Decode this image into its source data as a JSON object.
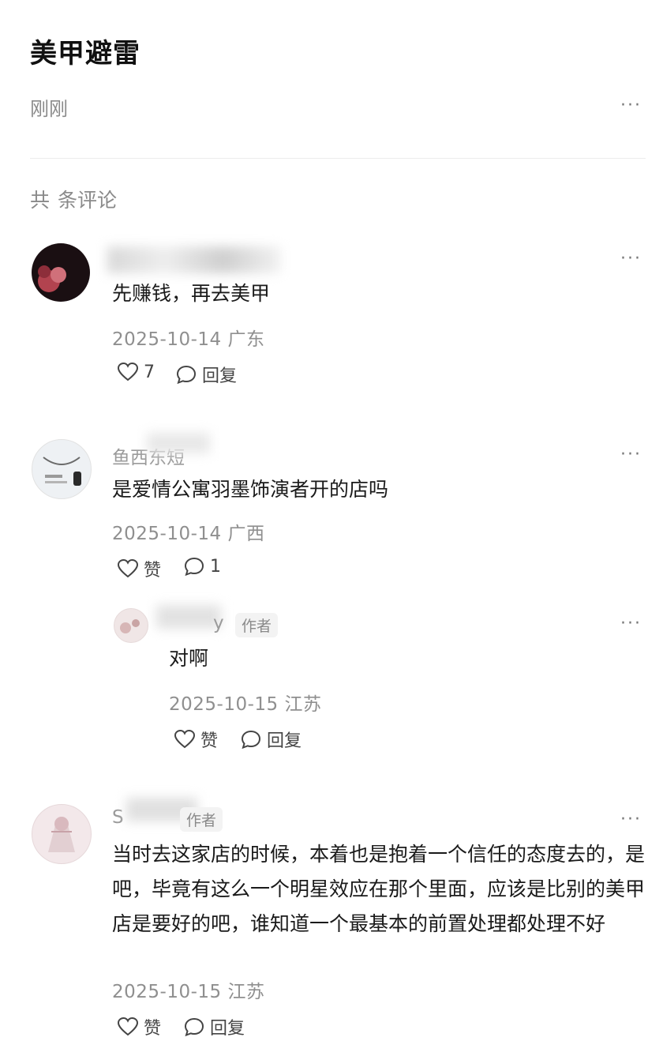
{
  "post": {
    "title": "美甲避雷",
    "time": "刚刚",
    "more": "···"
  },
  "comments_header": {
    "prefix": "共",
    "suffix": "条评论"
  },
  "comments": [
    {
      "content": "先赚钱，再去美甲",
      "meta": "2025-10-14 广东",
      "like_label": "7",
      "reply_label": "回复",
      "more": "···"
    },
    {
      "name_visible": "鱼西东短",
      "content": "是爱情公寓羽墨饰演者开的店吗",
      "meta": "2025-10-14 广西",
      "like_label": "赞",
      "reply_label": "1",
      "more": "···"
    },
    {
      "name_visible": "y",
      "author_tag": "作者",
      "content": "对啊",
      "meta": "2025-10-15 江苏",
      "like_label": "赞",
      "reply_label": "回复",
      "more": "···"
    },
    {
      "name_visible": "S",
      "author_tag": "作者",
      "content": "当时去这家店的时候，本着也是抱着一个信任的态度去的，是吧，毕竟有这么一个明星效应在那个里面，应该是比别的美甲店是要好的吧，谁知道一个最基本的前置处理都处理不好",
      "meta": "2025-10-15 江苏",
      "like_label": "赞",
      "reply_label": "回复",
      "more": "···"
    }
  ]
}
